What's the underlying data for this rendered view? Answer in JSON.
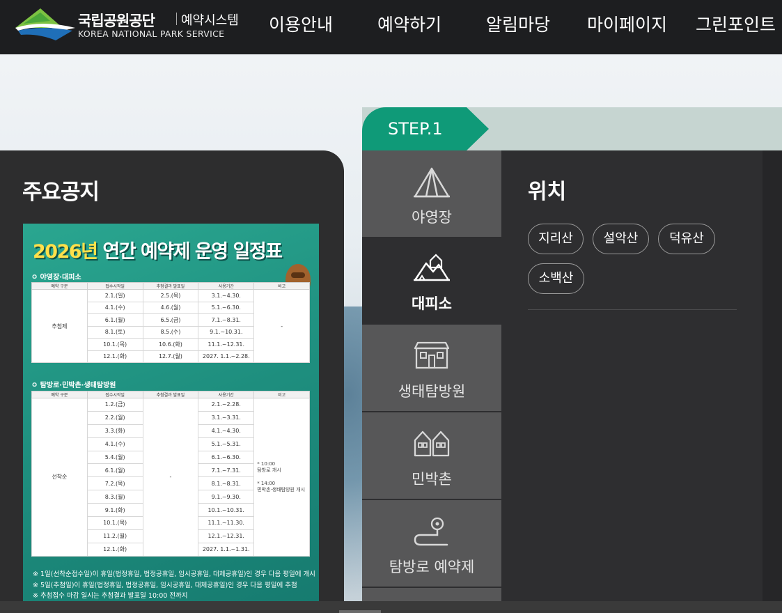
{
  "header": {
    "logo_kr": "국립공원공단",
    "logo_sys": "예약시스템",
    "logo_en": "KOREA NATIONAL PARK SERVICE",
    "nav": [
      "이용안내",
      "예약하기",
      "알림마당",
      "마이페이지",
      "그린포인트"
    ]
  },
  "notice": {
    "title": "주요공지",
    "poster": {
      "title_year": "2026년",
      "title_rest": " 연간 예약제 운영 일정표",
      "section1": "ㅇ 야영장·대피소",
      "section2": "ㅇ 탐방로·민박촌·생태탐방원",
      "headers": [
        "예약 구분",
        "접수시작일",
        "추첨결과 발표일",
        "사용기간",
        "비고"
      ],
      "table1": {
        "type": "추첨제",
        "note": "-",
        "rows": [
          [
            "2.1.(일)",
            "2.5.(목)",
            "3.1.~4.30."
          ],
          [
            "4.1.(수)",
            "4.6.(월)",
            "5.1.~6.30."
          ],
          [
            "6.1.(월)",
            "6.5.(금)",
            "7.1.~8.31."
          ],
          [
            "8.1.(토)",
            "8.5.(수)",
            "9.1.~10.31."
          ],
          [
            "10.1.(목)",
            "10.6.(화)",
            "11.1.~12.31."
          ],
          [
            "12.1.(화)",
            "12.7.(월)",
            "2027. 1.1.~2.28."
          ]
        ]
      },
      "table2": {
        "type": "선착순",
        "result": "-",
        "note1": "* 10:00",
        "note1_sub": "탐방로 개시",
        "note2": "* 14:00",
        "note2_sub": "민박촌·생태탐방원 개시",
        "rows": [
          [
            "1.2.(금)",
            "2.1.~2.28."
          ],
          [
            "2.2.(월)",
            "3.1.~3.31."
          ],
          [
            "3.3.(화)",
            "4.1.~4.30."
          ],
          [
            "4.1.(수)",
            "5.1.~5.31."
          ],
          [
            "5.4.(월)",
            "6.1.~6.30."
          ],
          [
            "6.1.(월)",
            "7.1.~7.31."
          ],
          [
            "7.2.(목)",
            "8.1.~8.31."
          ],
          [
            "8.3.(월)",
            "9.1.~9.30."
          ],
          [
            "9.1.(화)",
            "10.1.~10.31."
          ],
          [
            "10.1.(목)",
            "11.1.~11.30."
          ],
          [
            "11.2.(월)",
            "12.1.~12.31."
          ],
          [
            "12.1.(화)",
            "2027. 1.1.~1.31."
          ]
        ]
      },
      "notes": [
        "※ 1일(선착순접수일)이 휴일(법정휴일, 법정공휴일, 임시공휴일, 대체공휴일)인 경우 다음 평일에 개시",
        "※ 5일(추첨일)이 휴일(법정휴일, 법정공휴일, 임시공휴일, 대체공휴일)인 경우 다음 평일에 추첨",
        "※ 추첨접수 마감 일시는 추첨결과 발표일 10:00 전까지"
      ]
    }
  },
  "step": {
    "label": "STEP.1"
  },
  "categories": [
    {
      "label": "야영장",
      "icon": "tent-icon",
      "active": false
    },
    {
      "label": "대피소",
      "icon": "shelter-icon",
      "active": true
    },
    {
      "label": "생태탐방원",
      "icon": "eco-center-icon",
      "active": false
    },
    {
      "label": "민박촌",
      "icon": "lodging-icon",
      "active": false
    },
    {
      "label": "탐방로 예약제",
      "icon": "trail-icon",
      "active": false
    }
  ],
  "location": {
    "title": "위치",
    "chips": [
      "지리산",
      "설악산",
      "덕유산",
      "소백산"
    ]
  },
  "colors": {
    "header_bg": "#1d1e20",
    "accent_green": "#0f9a78",
    "panel_dark": "#2e2e30",
    "inactive_tab": "#575758",
    "poster_green": "#1e8e7e",
    "poster_title_yellow": "#ffe04a"
  }
}
